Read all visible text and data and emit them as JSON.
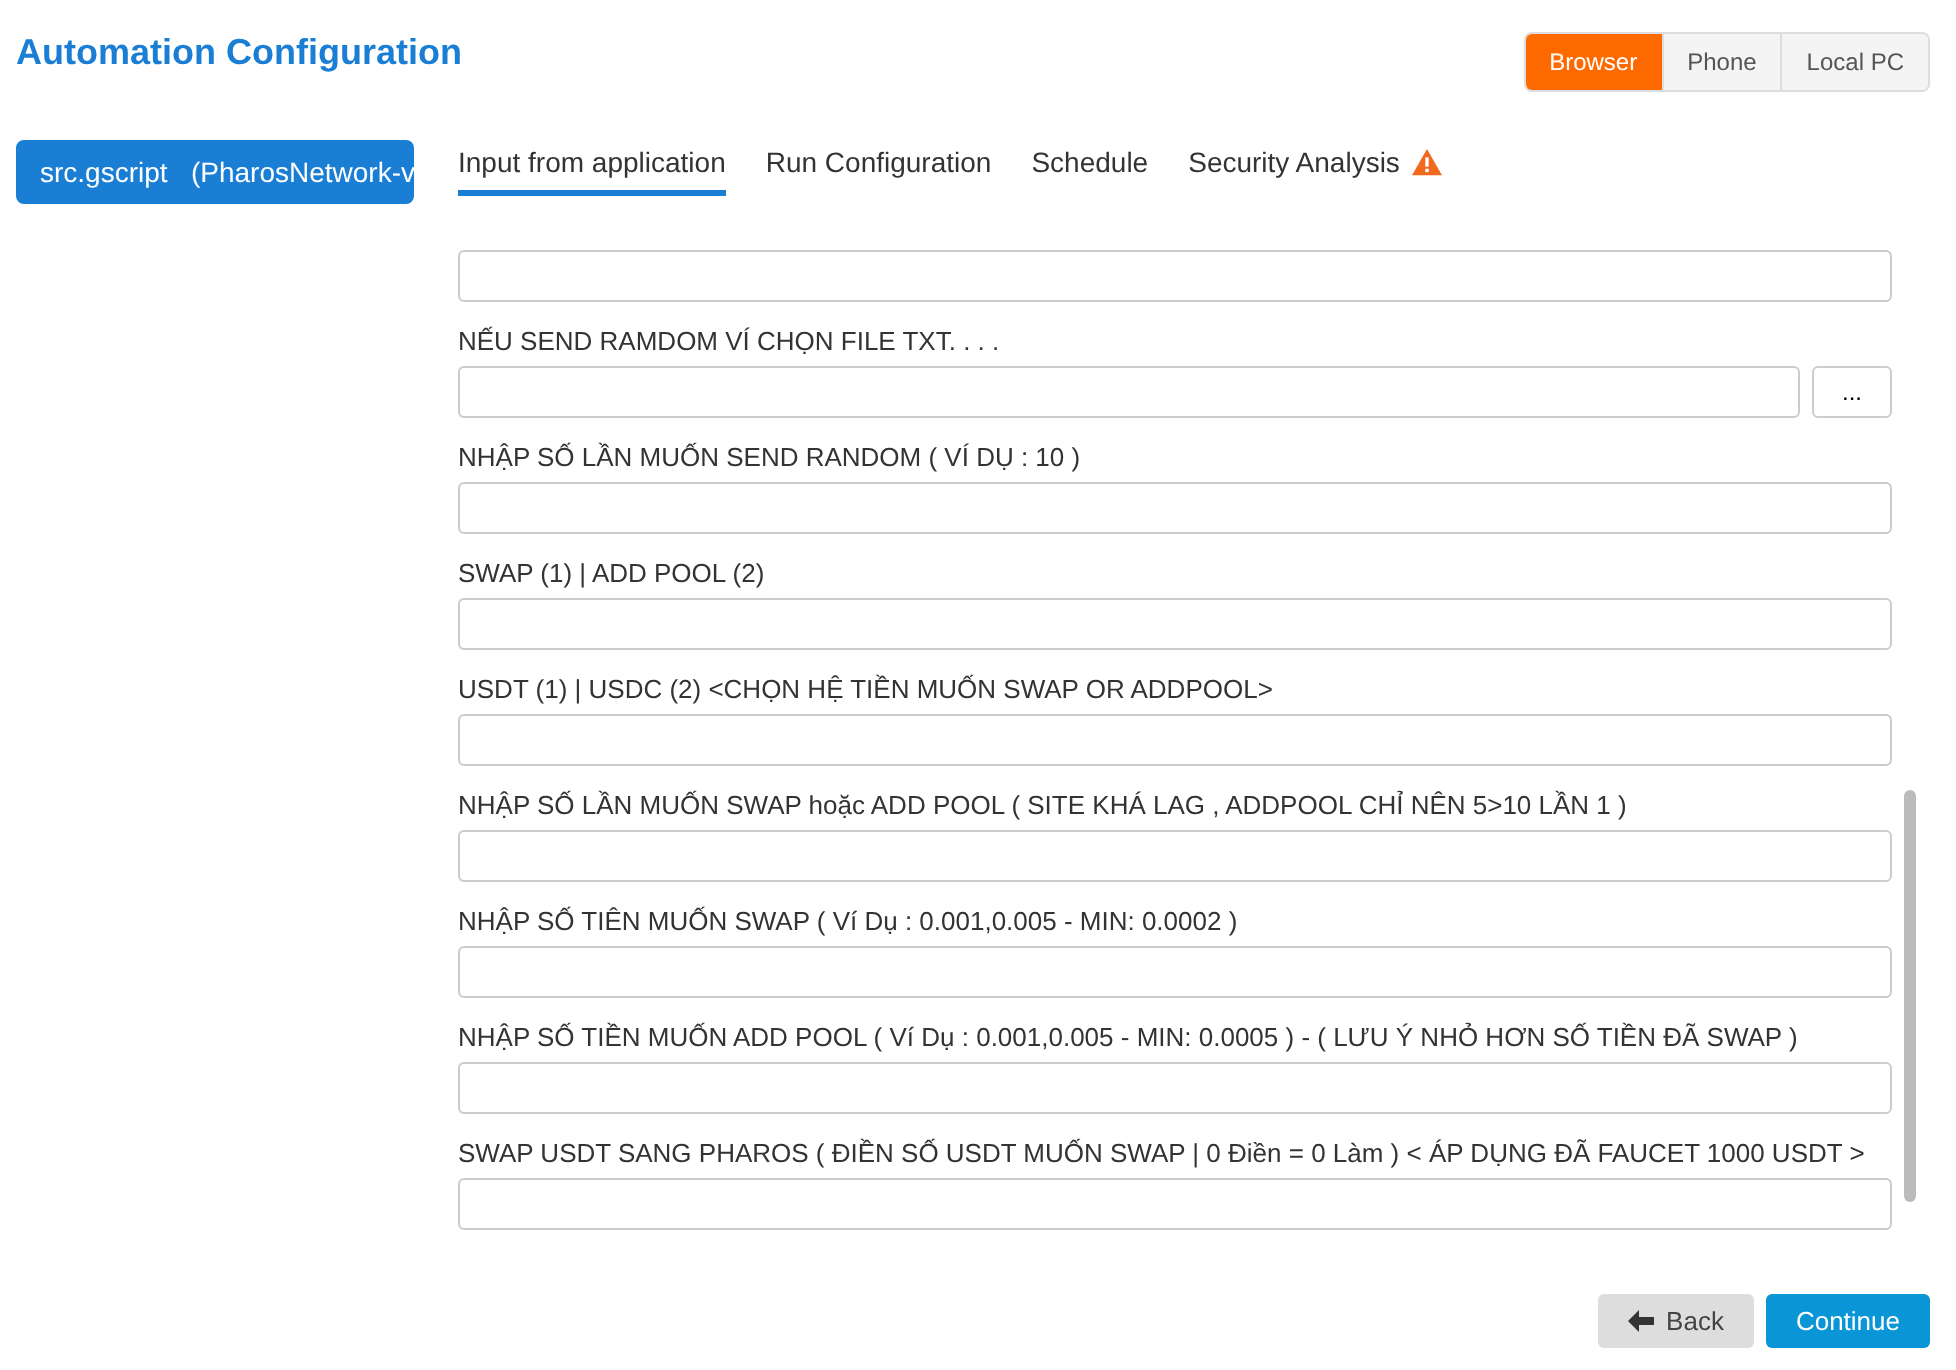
{
  "title": "Automation Configuration",
  "modes": [
    {
      "label": "Browser",
      "selected": true
    },
    {
      "label": "Phone",
      "selected": false
    },
    {
      "label": "Local PC",
      "selected": false
    }
  ],
  "sidebar": {
    "items": [
      {
        "label": "src.gscript   (PharosNetwork-v",
        "selected": true
      }
    ]
  },
  "tabs": [
    {
      "label": "Input from application",
      "selected": true,
      "warning": false
    },
    {
      "label": "Run Configuration",
      "selected": false,
      "warning": false
    },
    {
      "label": "Schedule",
      "selected": false,
      "warning": false
    },
    {
      "label": "Security Analysis",
      "selected": false,
      "warning": true
    }
  ],
  "fields": [
    {
      "kind": "text"
    },
    {
      "kind": "file",
      "label": "NẾU SEND RAMDOM VÍ CHỌN FILE TXT. . . .",
      "browse": "..."
    },
    {
      "kind": "text",
      "label": "NHẬP SỐ LẦN MUỐN SEND RANDOM ( VÍ DỤ : 10 )"
    },
    {
      "kind": "text",
      "label": "SWAP (1) | ADD POOL (2)"
    },
    {
      "kind": "text",
      "label": "USDT (1) | USDC (2) <CHỌN HỆ TIỀN MUỐN SWAP OR ADDPOOL>"
    },
    {
      "kind": "text",
      "label": "NHẬP SỐ LẦN MUỐN SWAP hoặc ADD POOL ( SITE KHÁ LAG , ADDPOOL CHỈ NÊN 5>10 LẦN 1 )"
    },
    {
      "kind": "text",
      "label": "NHẬP SỐ TIÊN MUỐN SWAP ( Ví Dụ : 0.001,0.005 - MIN: 0.0002 )"
    },
    {
      "kind": "text",
      "label": "NHẬP SỐ TIỀN MUỐN ADD POOL ( Ví Dụ : 0.001,0.005 - MIN: 0.0005 ) - ( LƯU Ý NHỎ HƠN SỐ TIỀN ĐÃ SWAP )"
    },
    {
      "kind": "text",
      "label": "SWAP USDT SANG PHAROS ( ĐIỀN SỐ USDT MUỐN SWAP | 0 Điền = 0 Làm ) < ÁP DỤNG ĐÃ FAUCET 1000 USDT >"
    }
  ],
  "buttons": {
    "back": "Back",
    "continue": "Continue"
  }
}
